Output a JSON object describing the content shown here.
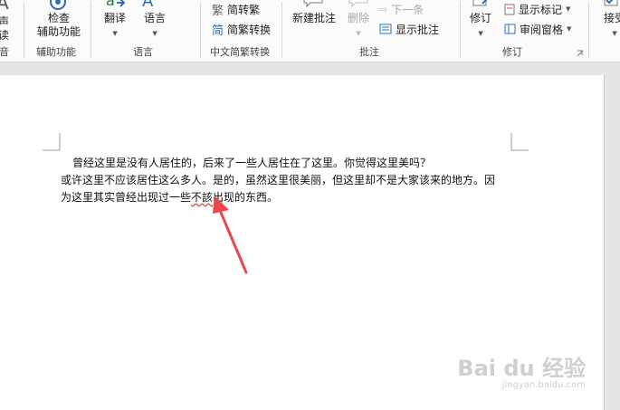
{
  "ribbon": {
    "groups": [
      {
        "items": [
          "声",
          "读"
        ],
        "label": "音"
      },
      {
        "items": [
          "检查",
          "辅助功能"
        ],
        "label": "辅助功能"
      },
      {
        "items": [
          "翻译",
          "语言"
        ],
        "label": "语言"
      },
      {
        "items": [
          "简转繁",
          "简繁转换"
        ],
        "label": "中文简繁转换"
      },
      {
        "items": [
          "新建批注",
          "删除",
          "下一条",
          "显示批注"
        ],
        "label": "批注"
      },
      {
        "items": [
          "修订",
          "显示标记",
          "审阅窗格"
        ],
        "label": "修订"
      },
      {
        "items": [
          "接受"
        ],
        "label": ""
      }
    ],
    "fan_icon_text": "繁",
    "jian_icon_text": "简",
    "accessibility_icon_text": "A"
  },
  "document": {
    "paragraph_line1": "曾经这里是没有人居住的，后来了一些人居住在了这里。你觉得这里美吗？",
    "paragraph_line2": "或许这里不应该居住这么多人。是的，虽然这里很美丽，但这里却不是大家该来的地方。因",
    "paragraph_line3_before": "为这里其实曾经出现过一些",
    "paragraph_line3_error": "不該",
    "paragraph_line3_after": "出现的东西。"
  },
  "annotation": {
    "arrow_color": "#e8474c"
  },
  "watermark": {
    "brand": "Bai du 经验",
    "url": "jingyan.baidu.com"
  }
}
